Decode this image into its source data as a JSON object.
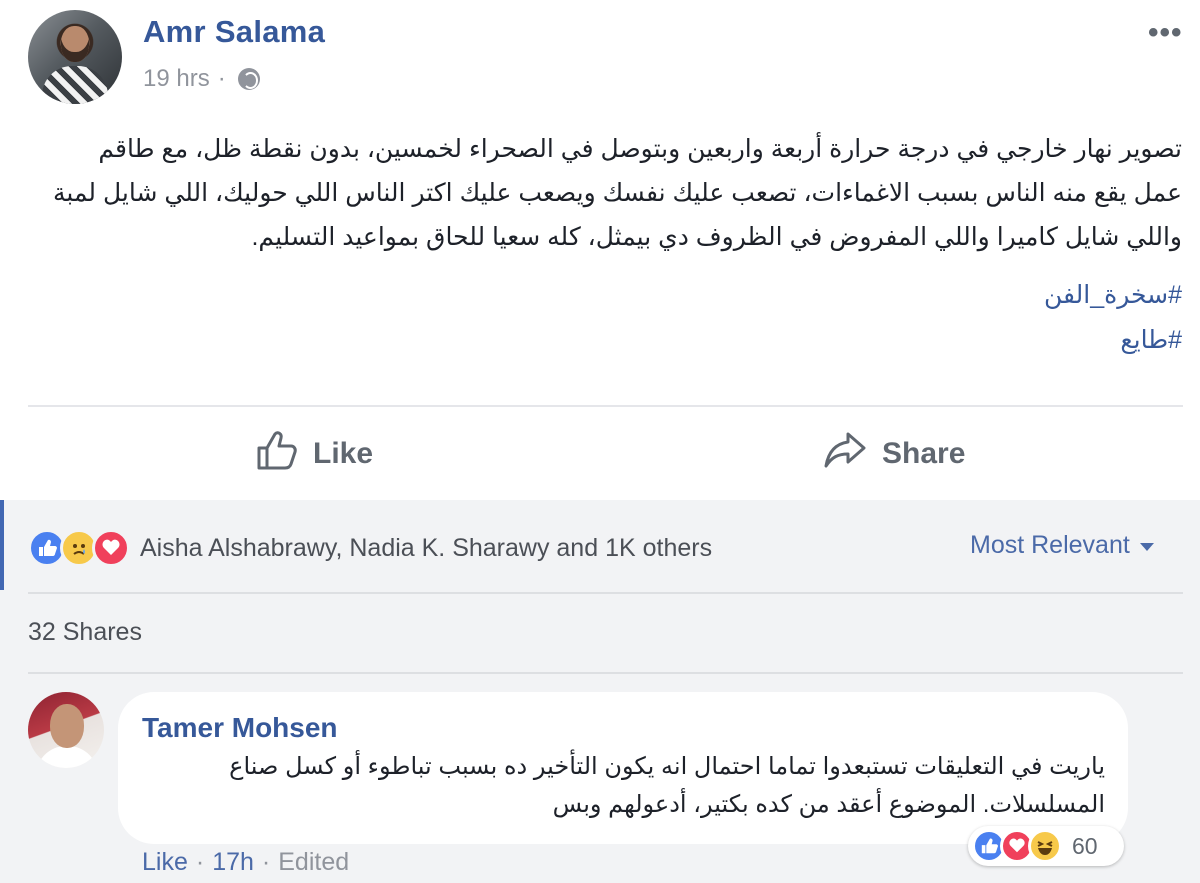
{
  "post": {
    "author": "Amr Salama",
    "timestamp": "19 hrs",
    "separator": "·",
    "privacy_icon": "globe-icon",
    "more_icon": "ellipsis-icon",
    "text_lines": [
      "تصوير نهار خارجي في درجة حرارة أربعة واربعين وبتوصل في الصحراء لخمسين، بدون نقطة ظل، مع طاقم",
      "عمل يقع منه الناس بسبب الاغماءات، تصعب عليك نفسك ويصعب عليك اكتر الناس اللي حوليك، اللي شايل لمبة",
      "واللي شايل كاميرا واللي المفروض في الظروف دي بيمثل، كله سعيا للحاق بمواعيد التسليم."
    ],
    "hashtags": [
      "#سخرة_الفن",
      "#طايع"
    ]
  },
  "actions": {
    "like_label": "Like",
    "share_label": "Share"
  },
  "engagement": {
    "reaction_icons": [
      "like-reaction-icon",
      "sad-reaction-icon",
      "love-reaction-icon"
    ],
    "reactions_summary": "Aisha Alshabrawy, Nadia K. Sharawy and 1K others",
    "sort_label": "Most Relevant",
    "shares": "32 Shares"
  },
  "comment": {
    "author": "Tamer Mohsen",
    "text_lines": [
      "ياريت في التعليقات تستبعدوا تماما احتمال انه يكون التأخير ده بسبب تباطوء أو كسل صناع",
      "المسلسلات. الموضوع أعقد من كده بكتير، أدعولهم وبس"
    ],
    "reaction_count": "60",
    "reaction_icons": [
      "like-reaction-icon",
      "love-reaction-icon",
      "haha-reaction-icon"
    ],
    "footer": {
      "like": "Like",
      "sep1": "·",
      "time": "17h",
      "sep2": "·",
      "edited": "Edited"
    }
  },
  "colors": {
    "link_blue": "#365899",
    "meta_gray": "#90949c",
    "lower_bg": "#f2f3f5",
    "like_blue": "#4a80f0",
    "love_red": "#f0405b",
    "sad_yellow": "#f7c94a"
  }
}
